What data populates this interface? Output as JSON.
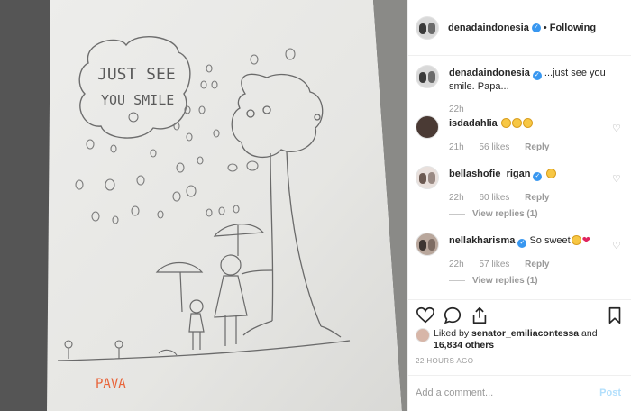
{
  "post": {
    "author": "denadaindonesia",
    "follow_status": "Following",
    "caption_text": "...just see you smile. Papa...",
    "caption_time": "22h",
    "timestamp": "22 HOURS AGO",
    "drawing_text_line1": "JUST SEE",
    "drawing_text_line2": "YOU SMILE",
    "drawing_signature": "PAVA"
  },
  "comments": [
    {
      "user": "isdadahlia",
      "text": "",
      "emoji": [
        "grinning",
        "grinning",
        "grinning"
      ],
      "time": "21h",
      "likes": "56 likes",
      "reply": "Reply",
      "view_replies": ""
    },
    {
      "user": "bellashofie_rigan",
      "text": "",
      "emoji": [
        "frowning"
      ],
      "time": "22h",
      "likes": "60 likes",
      "reply": "Reply",
      "view_replies": "View replies (1)"
    },
    {
      "user": "nellakharisma",
      "text": "So sweet",
      "emoji": [
        "smiling",
        "heart"
      ],
      "time": "22h",
      "likes": "57 likes",
      "reply": "Reply",
      "view_replies": "View replies (1)"
    }
  ],
  "likes": {
    "prefix": "Liked by ",
    "user": "senator_emiliacontessa",
    "mid": " and",
    "count": "16,834 others"
  },
  "add_comment": {
    "placeholder": "Add a comment...",
    "post_label": "Post"
  },
  "icons": [
    "heart-icon",
    "comment-icon",
    "share-icon",
    "bookmark-icon",
    "verified-badge-icon"
  ],
  "colors": {
    "verified": "#3897f0",
    "meta": "#999999",
    "post_button": "#b2dffc",
    "signature": "#e8643a"
  }
}
